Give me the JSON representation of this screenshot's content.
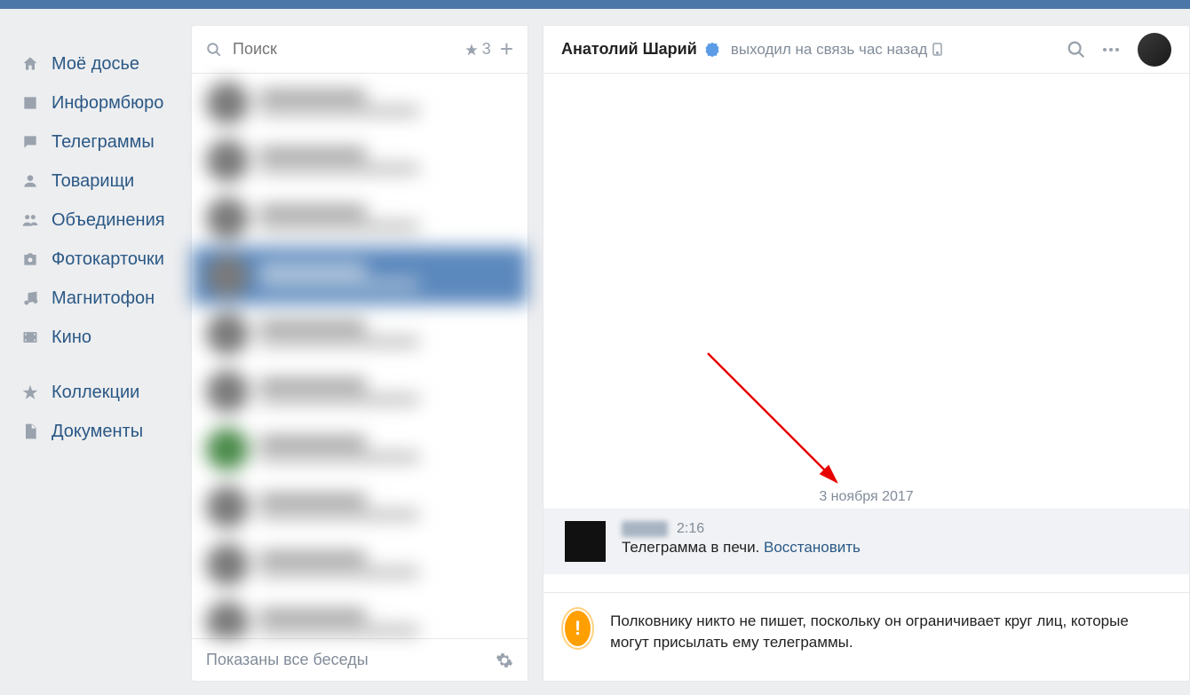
{
  "sidebar": {
    "items": [
      {
        "icon": "home-icon",
        "label": "Моё досье"
      },
      {
        "icon": "news-icon",
        "label": "Информбюро"
      },
      {
        "icon": "messages-icon",
        "label": "Телеграммы"
      },
      {
        "icon": "friends-icon",
        "label": "Товарищи"
      },
      {
        "icon": "groups-icon",
        "label": "Объединения"
      },
      {
        "icon": "photos-icon",
        "label": "Фотокарточки"
      },
      {
        "icon": "music-icon",
        "label": "Магнитофон"
      },
      {
        "icon": "video-icon",
        "label": "Кино"
      }
    ],
    "items2": [
      {
        "icon": "bookmarks-icon",
        "label": "Коллекции"
      },
      {
        "icon": "docs-icon",
        "label": "Документы"
      }
    ]
  },
  "dialogs": {
    "search_placeholder": "Поиск",
    "starred_count": "3",
    "footer_text": "Показаны все беседы"
  },
  "chat": {
    "contact_name": "Анатолий Шарий",
    "status_text": "выходил на связь час назад",
    "date_separator": "3 ноября 2017",
    "message": {
      "time": "2:16",
      "body": "Телеграмма в печи. ",
      "restore": "Восстановить"
    },
    "notice": "Полковнику никто не пишет, поскольку он ограничивает круг лиц, которые могут присылать ему телеграммы."
  },
  "colors": {
    "accent": "#4a76a8",
    "link": "#2a5885",
    "muted": "#818c99"
  }
}
